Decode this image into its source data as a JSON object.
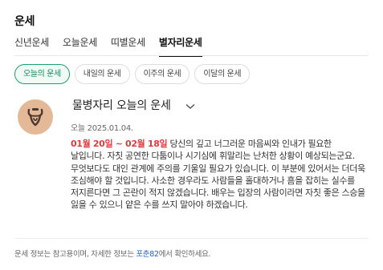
{
  "widget": {
    "title": "운세"
  },
  "main_tabs": [
    {
      "label": "신년운세"
    },
    {
      "label": "오늘운세"
    },
    {
      "label": "띠별운세"
    },
    {
      "label": "별자리운세",
      "active": true
    }
  ],
  "period_chips": [
    {
      "label": "오늘의 운세",
      "active": true
    },
    {
      "label": "내일의 운세"
    },
    {
      "label": "이주의 운세"
    },
    {
      "label": "이달의 운세"
    }
  ],
  "sign": {
    "selected": "물병자리 오늘의 운세",
    "icon": "aquarius-amphora-icon",
    "icon_color": "#e4b998"
  },
  "date_line": "오늘 2025.01.04.",
  "fortune": {
    "date_range": "01월 20일 ~ 02월 18일",
    "text": "당신의 깊고 너그러운 마음씨와 인내가 필요한 날입니다. 자칫 공연한 다툼이나 시기심에 휘말리는 난처한 상황이 예상되는군요. 무엇보다도 대인 관계에 주의를 기울일 필요가 있습니다. 이 부분에 있어서는 더더욱 조심해야 할 것입니다. 사소한 경우라도 사람들을 홀대하거나 흠을 잡히는 실수를 저지른다면 그 곤란이 적지 않겠습니다. 배우는 입장의 사람이라면 자칫 좋은 스승을 잃을 수 있으니 얕은 수를 쓰지 말아야 하겠습니다."
  },
  "footer": {
    "prefix": "운세 정보는 참고용이며, 자세한 정보는 ",
    "link": "포춘82",
    "suffix": "에서 확인하세요."
  },
  "colors": {
    "accent": "#1f9e6f",
    "date_range": "#e0393e",
    "link": "#1d5fd6"
  }
}
